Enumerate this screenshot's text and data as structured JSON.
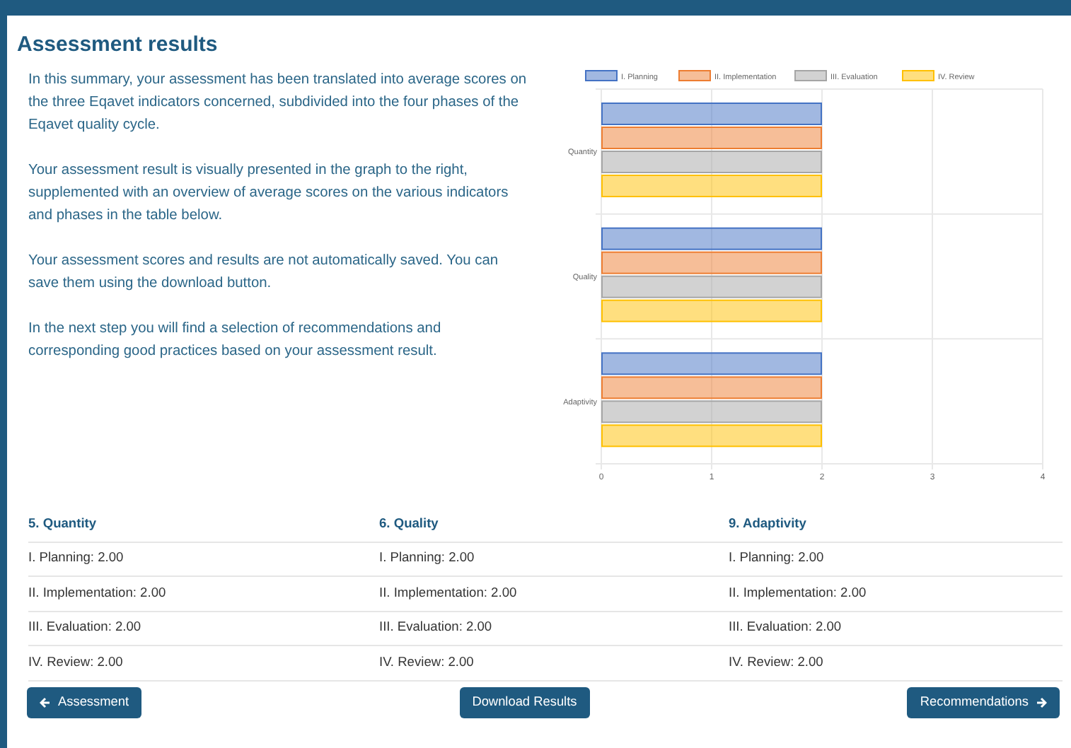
{
  "title": "Assessment results",
  "paragraphs": [
    "In this summary, your assessment has been translated into average scores on the three Eqavet indicators concerned, subdivided into the four phases of the Eqavet quality cycle.",
    "Your assessment result is visually presented in the graph to the right, supplemented with an overview of average scores on the various indicators and phases in the table below.",
    "Your assessment scores and results are not automatically saved. You can save them using the download button.",
    "In the next step you will find a selection of recommendations and corresponding good practices based on your assessment result."
  ],
  "chart_data": {
    "type": "bar",
    "orientation": "horizontal",
    "categories": [
      "Quantity",
      "Quality",
      "Adaptivity"
    ],
    "xlim": [
      0,
      4
    ],
    "grid": true,
    "legend": true,
    "xticks": [
      0,
      1,
      2,
      3,
      4
    ],
    "series": [
      {
        "name": "I. Planning",
        "color": "#4472c4",
        "values": [
          2,
          2,
          2
        ]
      },
      {
        "name": "II. Implementation",
        "color": "#ed7d31",
        "values": [
          2,
          2,
          2
        ]
      },
      {
        "name": "III. Evaluation",
        "color": "#a5a5a5",
        "values": [
          2,
          2,
          2
        ]
      },
      {
        "name": "IV. Review",
        "color": "#ffc000",
        "values": [
          2,
          2,
          2
        ]
      }
    ]
  },
  "table": {
    "columns": [
      {
        "heading": "5. Quantity",
        "rows": [
          "I. Planning: 2.00",
          "II. Implementation: 2.00",
          "III. Evaluation: 2.00",
          "IV. Review: 2.00"
        ]
      },
      {
        "heading": "6. Quality",
        "rows": [
          "I. Planning: 2.00",
          "II. Implementation: 2.00",
          "III. Evaluation: 2.00",
          "IV. Review: 2.00"
        ]
      },
      {
        "heading": "9. Adaptivity",
        "rows": [
          "I. Planning: 2.00",
          "II. Implementation: 2.00",
          "III. Evaluation: 2.00",
          "IV. Review: 2.00"
        ]
      }
    ]
  },
  "buttons": [
    {
      "label": "Assessment",
      "kind": "back"
    },
    {
      "label": "Download Results",
      "kind": "plain"
    },
    {
      "label": "Recommendations",
      "kind": "forward"
    }
  ]
}
